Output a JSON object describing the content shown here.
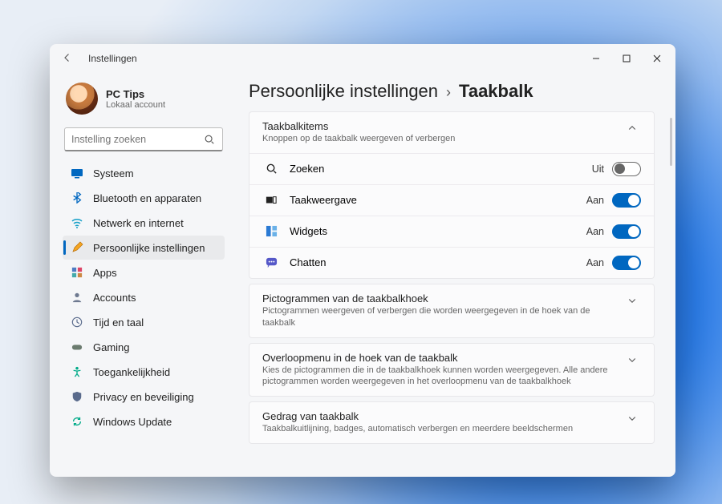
{
  "window": {
    "app_title": "Instellingen"
  },
  "profile": {
    "name": "PC Tips",
    "subtitle": "Lokaal account"
  },
  "search": {
    "placeholder": "Instelling zoeken"
  },
  "nav": {
    "items": [
      {
        "label": "Systeem"
      },
      {
        "label": "Bluetooth en apparaten"
      },
      {
        "label": "Netwerk en internet"
      },
      {
        "label": "Persoonlijke instellingen"
      },
      {
        "label": "Apps"
      },
      {
        "label": "Accounts"
      },
      {
        "label": "Tijd en taal"
      },
      {
        "label": "Gaming"
      },
      {
        "label": "Toegankelijkheid"
      },
      {
        "label": "Privacy en beveiliging"
      },
      {
        "label": "Windows Update"
      }
    ]
  },
  "breadcrumb": {
    "parent": "Persoonlijke instellingen",
    "current": "Taakbalk"
  },
  "sections": {
    "taskbar_items": {
      "title": "Taakbalkitems",
      "subtitle": "Knoppen op de taakbalk weergeven of verbergen",
      "rows": [
        {
          "label": "Zoeken",
          "state": "Uit",
          "on": false
        },
        {
          "label": "Taakweergave",
          "state": "Aan",
          "on": true
        },
        {
          "label": "Widgets",
          "state": "Aan",
          "on": true
        },
        {
          "label": "Chatten",
          "state": "Aan",
          "on": true
        }
      ]
    },
    "corner_icons": {
      "title": "Pictogrammen van de taakbalkhoek",
      "subtitle": "Pictogrammen weergeven of verbergen die worden weergegeven in de hoek van de taakbalk"
    },
    "overflow": {
      "title": "Overloopmenu in de hoek van de taakbalk",
      "subtitle": "Kies de pictogrammen die in de taakbalkhoek kunnen worden weergegeven. Alle andere pictogrammen worden weergegeven in het overloopmenu van de taakbalkhoek"
    },
    "behaviors": {
      "title": "Gedrag van taakbalk",
      "subtitle": "Taakbalkuitlijning, badges, automatisch verbergen en meerdere beeldschermen"
    }
  }
}
